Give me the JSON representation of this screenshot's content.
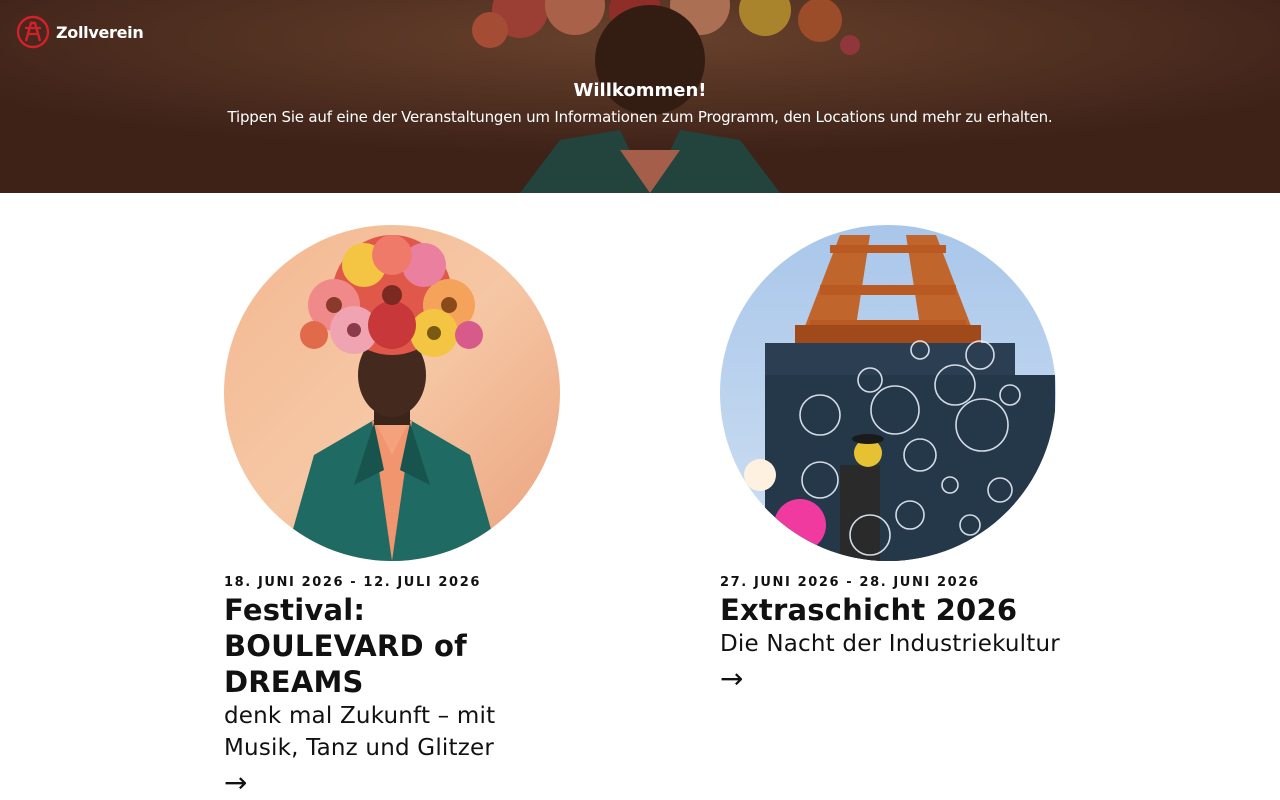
{
  "header": {
    "logo_text": "Zollverein",
    "welcome_title": "Willkommen!",
    "welcome_text": "Tippen Sie auf eine der Veranstaltungen um Informationen zum Programm, den Locations und mehr zu erhalten."
  },
  "events": [
    {
      "date": "18. JUNI 2026 - 12. JULI 2026",
      "title": "Festival: BOULEVARD of DREAMS",
      "subtitle": "denk mal Zukunft – mit Musik, Tanz und Glitzer",
      "arrow": "→",
      "image_icon": "flower-head-portrait"
    },
    {
      "date": "27. JUNI 2026 - 28. JUNI 2026",
      "title": "Extraschicht 2026",
      "subtitle": "Die Nacht der Industriekultur",
      "arrow": "→",
      "image_icon": "mine-tower-bubbles"
    }
  ],
  "colors": {
    "brand_red": "#d4202a",
    "text": "#111111",
    "hero_brown": "#5b3a2c"
  }
}
